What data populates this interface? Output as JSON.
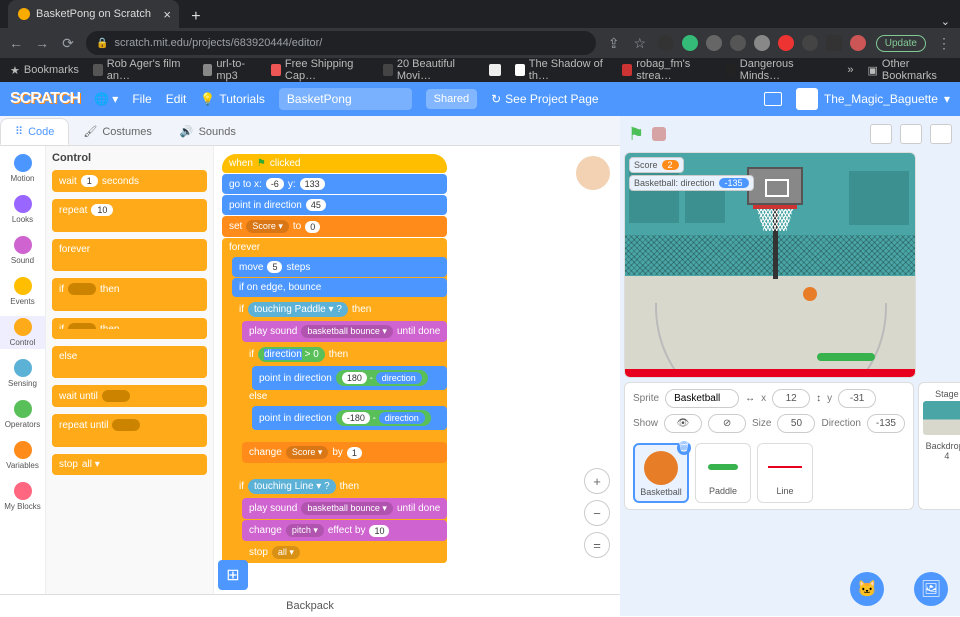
{
  "browser": {
    "tab_title": "BasketPong on Scratch",
    "url": "scratch.mit.edu/projects/683920444/editor/",
    "update_btn": "Update",
    "bookmarks": [
      "Bookmarks",
      "Rob Ager's film an…",
      "url-to-mp3",
      "Free Shipping Cap…",
      "20 Beautiful Movi…",
      "The Shadow of th…",
      "robag_fm's strea…",
      "Dangerous Minds…"
    ],
    "other_bookmarks": "Other Bookmarks"
  },
  "scratch": {
    "menu": {
      "file": "File",
      "edit": "Edit",
      "tutorials": "Tutorials",
      "project_name": "BasketPong",
      "shared": "Shared",
      "see_project": "See Project Page"
    },
    "username": "The_Magic_Baguette",
    "tabs": {
      "code": "Code",
      "costumes": "Costumes",
      "sounds": "Sounds"
    },
    "categories": [
      {
        "name": "Motion",
        "color": "#4c97ff"
      },
      {
        "name": "Looks",
        "color": "#9966ff"
      },
      {
        "name": "Sound",
        "color": "#cf63cf"
      },
      {
        "name": "Events",
        "color": "#ffbf00"
      },
      {
        "name": "Control",
        "color": "#ffab19"
      },
      {
        "name": "Sensing",
        "color": "#5cb1d6"
      },
      {
        "name": "Operators",
        "color": "#59c059"
      },
      {
        "name": "Variables",
        "color": "#ff8c1a"
      },
      {
        "name": "My Blocks",
        "color": "#ff6680"
      }
    ],
    "palette_title": "Control",
    "palette_blocks": {
      "wait": "wait",
      "wait_val": "1",
      "seconds": "seconds",
      "repeat": "repeat",
      "repeat_val": "10",
      "forever": "forever",
      "if": "if",
      "then": "then",
      "else": "else",
      "wait_until": "wait until",
      "repeat_until": "repeat until",
      "stop": "stop",
      "stop_opt": "all ▾"
    },
    "script": {
      "hat": "when",
      "hat2": "clicked",
      "goto": "go to x:",
      "gx": "-6",
      "gy": "133",
      "ylab": "y:",
      "point_dir": "point in direction",
      "pd_val": "45",
      "set": "set",
      "score_var": "Score ▾",
      "to": "to",
      "zero": "0",
      "forever": "forever",
      "move": "move",
      "mv_val": "5",
      "steps": "steps",
      "edge": "if on edge, bounce",
      "if": "if",
      "then": "then",
      "else": "else",
      "touching": "touching",
      "paddle": "Paddle ▾",
      "q": "?",
      "play": "play sound",
      "bounce_snd": "basketball bounce ▾",
      "until_done": "until done",
      "dir": "direction",
      "gt": ">",
      "zero2": "0",
      "pd180": "180",
      "minus": "-",
      "pdneg180": "-180",
      "change": "change",
      "by": "by",
      "one": "1",
      "line": "Line ▾",
      "pitch": "pitch ▾",
      "effect_by": "effect by",
      "ten": "10",
      "stop": "stop",
      "all": "all ▾"
    },
    "backpack": "Backpack",
    "stage_monitors": {
      "score_label": "Score",
      "score_val": "2",
      "dir_label": "Basketball: direction",
      "dir_val": "-135"
    },
    "sprite_info": {
      "sprite_lab": "Sprite",
      "sprite_name": "Basketball",
      "x_lab": "x",
      "x_val": "12",
      "y_lab": "y",
      "y_val": "-31",
      "show_lab": "Show",
      "size_lab": "Size",
      "size_val": "50",
      "dir_lab": "Direction",
      "dir_val": "-135"
    },
    "stage_panel": {
      "title": "Stage",
      "backdrops": "Backdrops",
      "count": "4"
    },
    "sprites": [
      {
        "name": "Basketball"
      },
      {
        "name": "Paddle"
      },
      {
        "name": "Line"
      }
    ]
  }
}
